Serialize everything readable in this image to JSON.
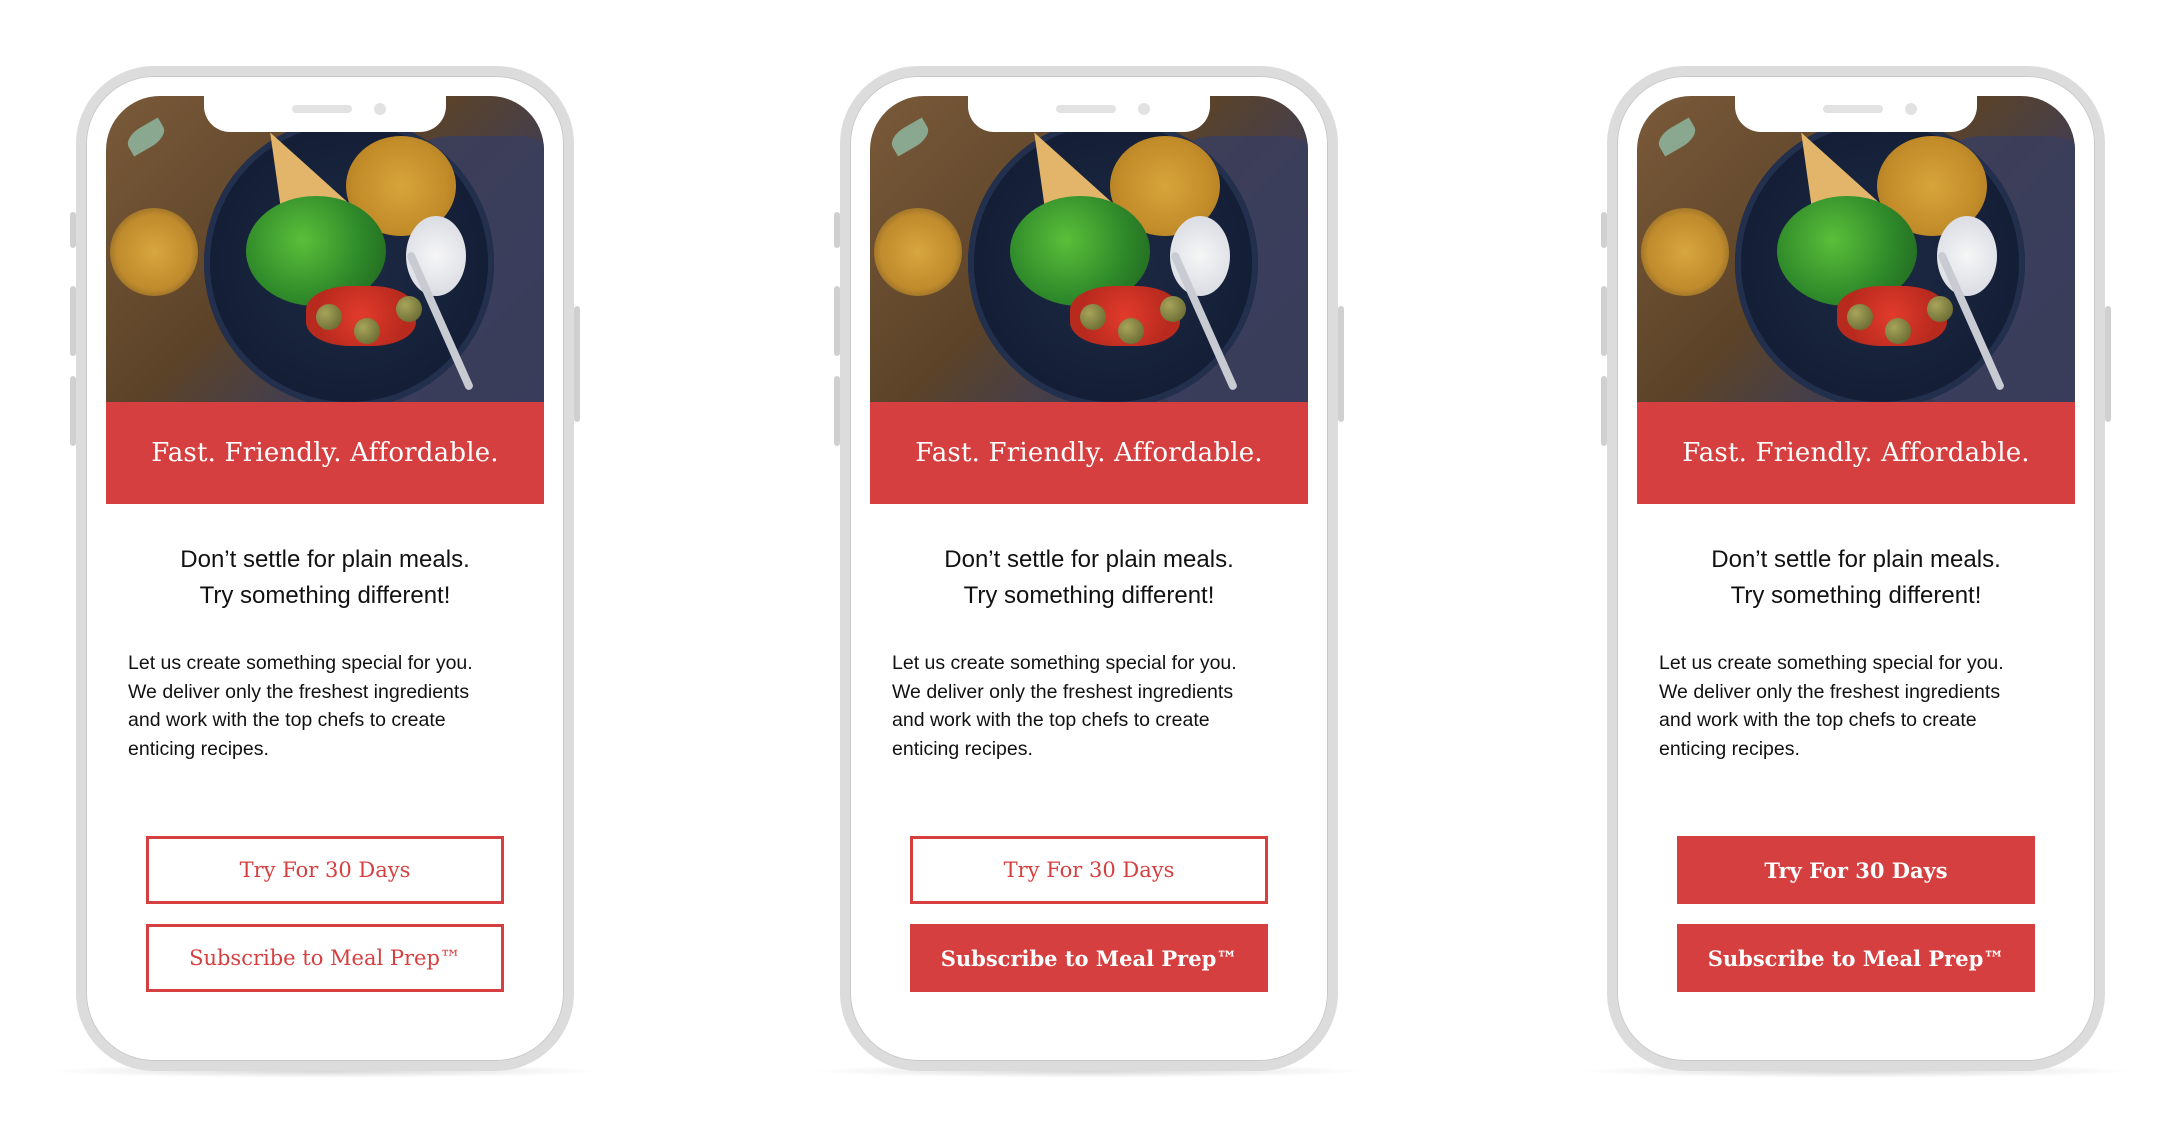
{
  "colors": {
    "accent": "#d63f3f",
    "text": "#111111",
    "device_frame": "#dcdcdc"
  },
  "screen": {
    "banner": "Fast. Friendly. Affordable.",
    "headline_line1": "Don’t settle for plain meals.",
    "headline_line2": "Try something different!",
    "body_line1": "Let us create something special for you.",
    "body_line2": "We deliver only the freshest ingredients",
    "body_line3": "and work with the top chefs to create",
    "body_line4": "enticing recipes.",
    "try_button": "Try For 30 Days",
    "subscribe_button": "Subscribe to Meal Prep™"
  },
  "variants": [
    {
      "name": "both-outline",
      "try_style": "outline",
      "subscribe_style": "outline"
    },
    {
      "name": "subscribe-filled",
      "try_style": "outline",
      "subscribe_style": "filled"
    },
    {
      "name": "both-filled",
      "try_style": "filled",
      "subscribe_style": "filled"
    }
  ],
  "icons": {
    "speaker": "speaker-grille-icon",
    "camera": "front-camera-icon"
  }
}
